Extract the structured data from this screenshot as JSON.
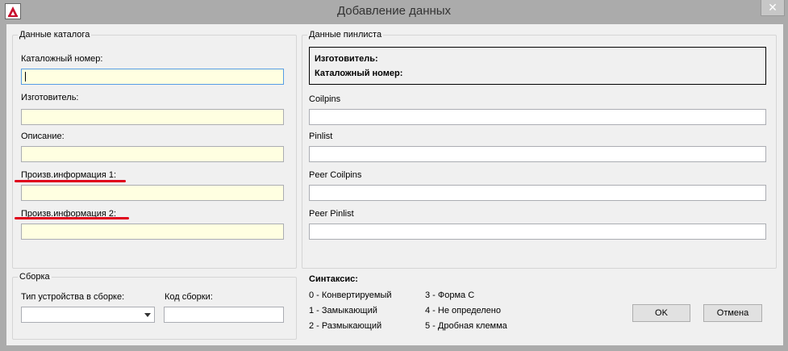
{
  "window": {
    "title": "Добавление данных",
    "close_symbol": "✕"
  },
  "catalog": {
    "group_title": "Данные каталога",
    "catalog_number_label": "Каталожный номер:",
    "manufacturer_label": "Изготовитель:",
    "description_label": "Описание:",
    "user_info1_label": "Произв.информация 1:",
    "user_info2_label": "Произв.информация 2:"
  },
  "assembly": {
    "group_title": "Сборка",
    "device_type_label": "Тип устройства в сборке:",
    "assembly_code_label": "Код сборки:"
  },
  "pinlist": {
    "group_title": "Данные пинлиста",
    "manufacturer_label": "Изготовитель:",
    "catalog_number_label": "Каталожный номер:",
    "coilpins_label": "Coilpins",
    "pinlist_label": "Pinlist",
    "peer_coilpins_label": "Peer Coilpins",
    "peer_pinlist_label": "Peer Pinlist"
  },
  "syntax": {
    "title": "Синтаксис:",
    "col1": [
      "0 - Конвертируемый",
      "1 - Замыкающий",
      "2 - Размыкающий"
    ],
    "col2": [
      "3 - Форма С",
      "4 - Не определено",
      "5 - Дробная клемма"
    ]
  },
  "buttons": {
    "ok": "OK",
    "cancel": "Отмена"
  },
  "colors": {
    "highlight_underline": "#e0001b",
    "required_field_bg": "#ffffe1"
  }
}
